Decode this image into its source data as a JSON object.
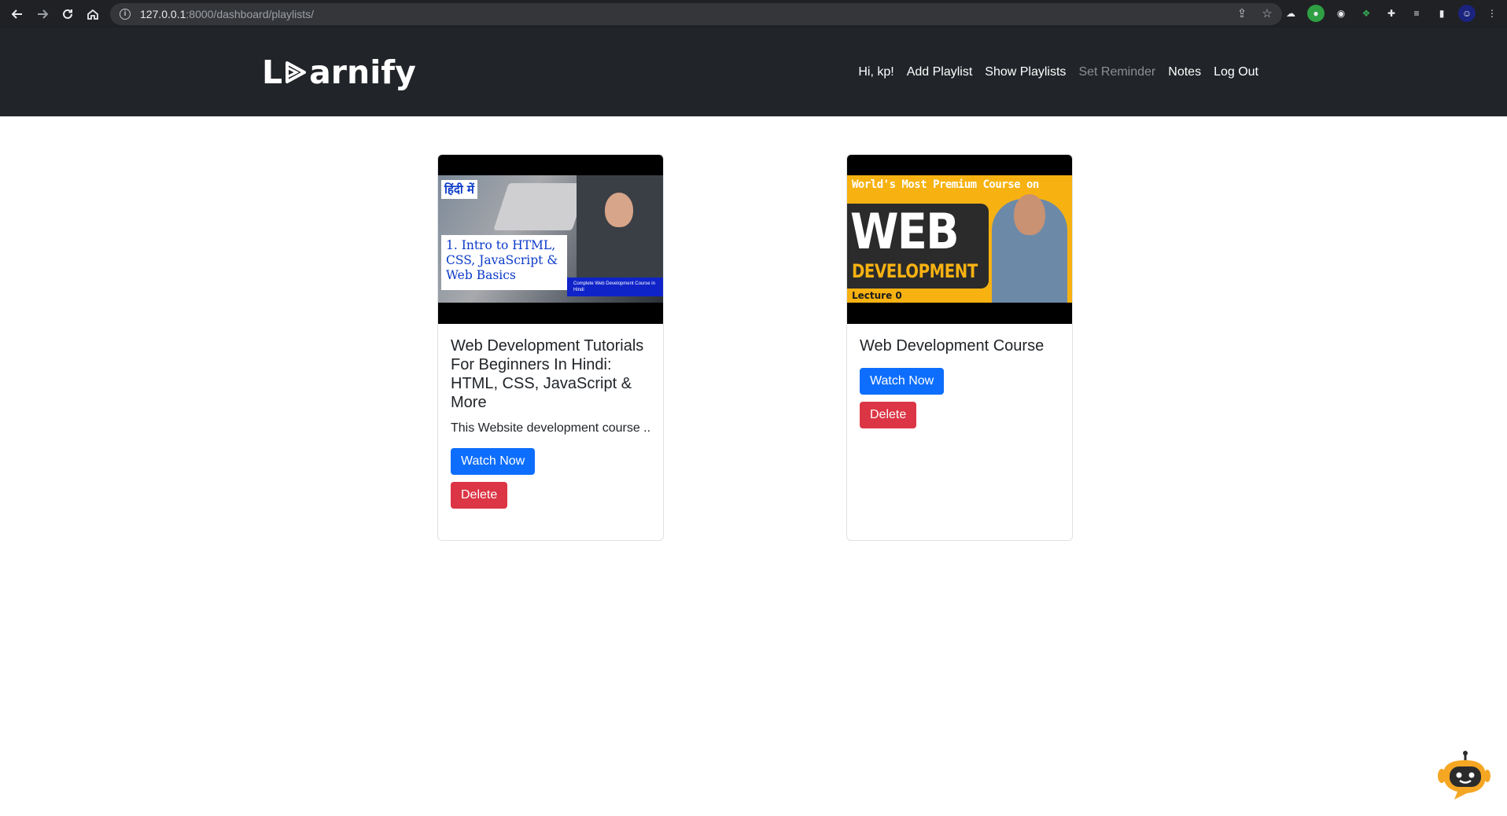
{
  "browser": {
    "url_host": "127.0.0.1",
    "url_path": ":8000/dashboard/playlists/"
  },
  "navbar": {
    "brand_prefix": "L",
    "brand_suffix": "arnify",
    "links": [
      {
        "label": "Hi, kp!",
        "disabled": false
      },
      {
        "label": "Add Playlist",
        "disabled": false
      },
      {
        "label": "Show Playlists",
        "disabled": false
      },
      {
        "label": "Set Reminder",
        "disabled": true
      },
      {
        "label": "Notes",
        "disabled": false
      },
      {
        "label": "Log Out",
        "disabled": false
      }
    ]
  },
  "playlists": [
    {
      "title": "Web Development Tutorials For Beginners In Hindi: HTML, CSS, JavaScript & More",
      "description": "This Website development course ...",
      "thumbnail": {
        "badge": "हिंदी में",
        "heading": "1. Intro to HTML, CSS, JavaScript & Web Basics",
        "footer": "Complete Web Development Course in Hindi"
      },
      "watch_label": "Watch Now",
      "delete_label": "Delete"
    },
    {
      "title": "Web Development Course",
      "thumbnail": {
        "top": "World's Most Premium Course on",
        "big": "WEB",
        "sub": "DEVELOPMENT",
        "lecture": "Lecture 0"
      },
      "watch_label": "Watch Now",
      "delete_label": "Delete"
    }
  ],
  "colors": {
    "navbar_bg": "#212529",
    "primary": "#0d6efd",
    "danger": "#dc3545"
  }
}
